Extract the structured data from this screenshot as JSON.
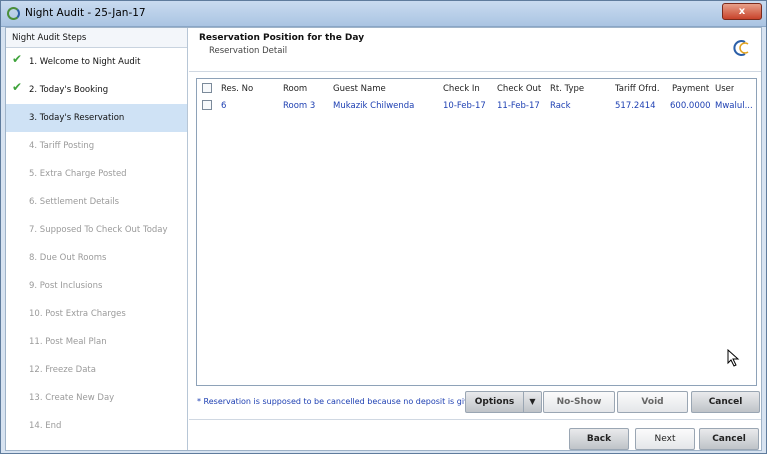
{
  "window": {
    "title": "Night Audit - 25-Jan-17",
    "close_label": "x"
  },
  "sidebar": {
    "header": "Night Audit Steps",
    "steps": [
      {
        "label": "1.  Welcome to Night Audit",
        "state": "done"
      },
      {
        "label": "2.  Today's Booking",
        "state": "done"
      },
      {
        "label": "3.  Today's Reservation",
        "state": "active"
      },
      {
        "label": "4.  Tariff Posting",
        "state": "pending"
      },
      {
        "label": "5.  Extra Charge Posted",
        "state": "pending"
      },
      {
        "label": "6.  Settlement Details",
        "state": "pending"
      },
      {
        "label": "7.  Supposed To Check Out Today",
        "state": "pending"
      },
      {
        "label": "8.  Due Out Rooms",
        "state": "pending"
      },
      {
        "label": "9. Post Inclusions",
        "state": "pending"
      },
      {
        "label": "10.  Post Extra Charges",
        "state": "pending"
      },
      {
        "label": "11.  Post Meal Plan",
        "state": "pending"
      },
      {
        "label": "12.  Freeze Data",
        "state": "pending"
      },
      {
        "label": "13.  Create New Day",
        "state": "pending"
      },
      {
        "label": "14.  End",
        "state": "pending"
      }
    ]
  },
  "main": {
    "title": "Reservation Position for the Day",
    "subtitle": "Reservation Detail"
  },
  "grid": {
    "columns": [
      "Res. No",
      "Room",
      "Guest Name",
      "Check In",
      "Check Out",
      "Rt. Type",
      "Tariff Ofrd.",
      "Payment",
      "User"
    ],
    "rows": [
      [
        "6",
        "Room 3",
        "Mukazik Chilwenda",
        "10-Feb-17",
        "11-Feb-17",
        "Rack",
        "517.2414",
        "600.0000",
        "Mwalul..."
      ]
    ]
  },
  "footer": {
    "message": "* Reservation is supposed to be cancelled because no deposit is given.",
    "options_label": "Options",
    "noshow_label": "No-Show",
    "void_label": "Void",
    "cancel_res_label": "Cancel",
    "back_label": "Back",
    "next_label": "Next",
    "cancel_label": "Cancel"
  },
  "colors": {
    "accent": "#1d3fb2",
    "active_step": "#cfe2f5",
    "check": "#3ea33b"
  }
}
